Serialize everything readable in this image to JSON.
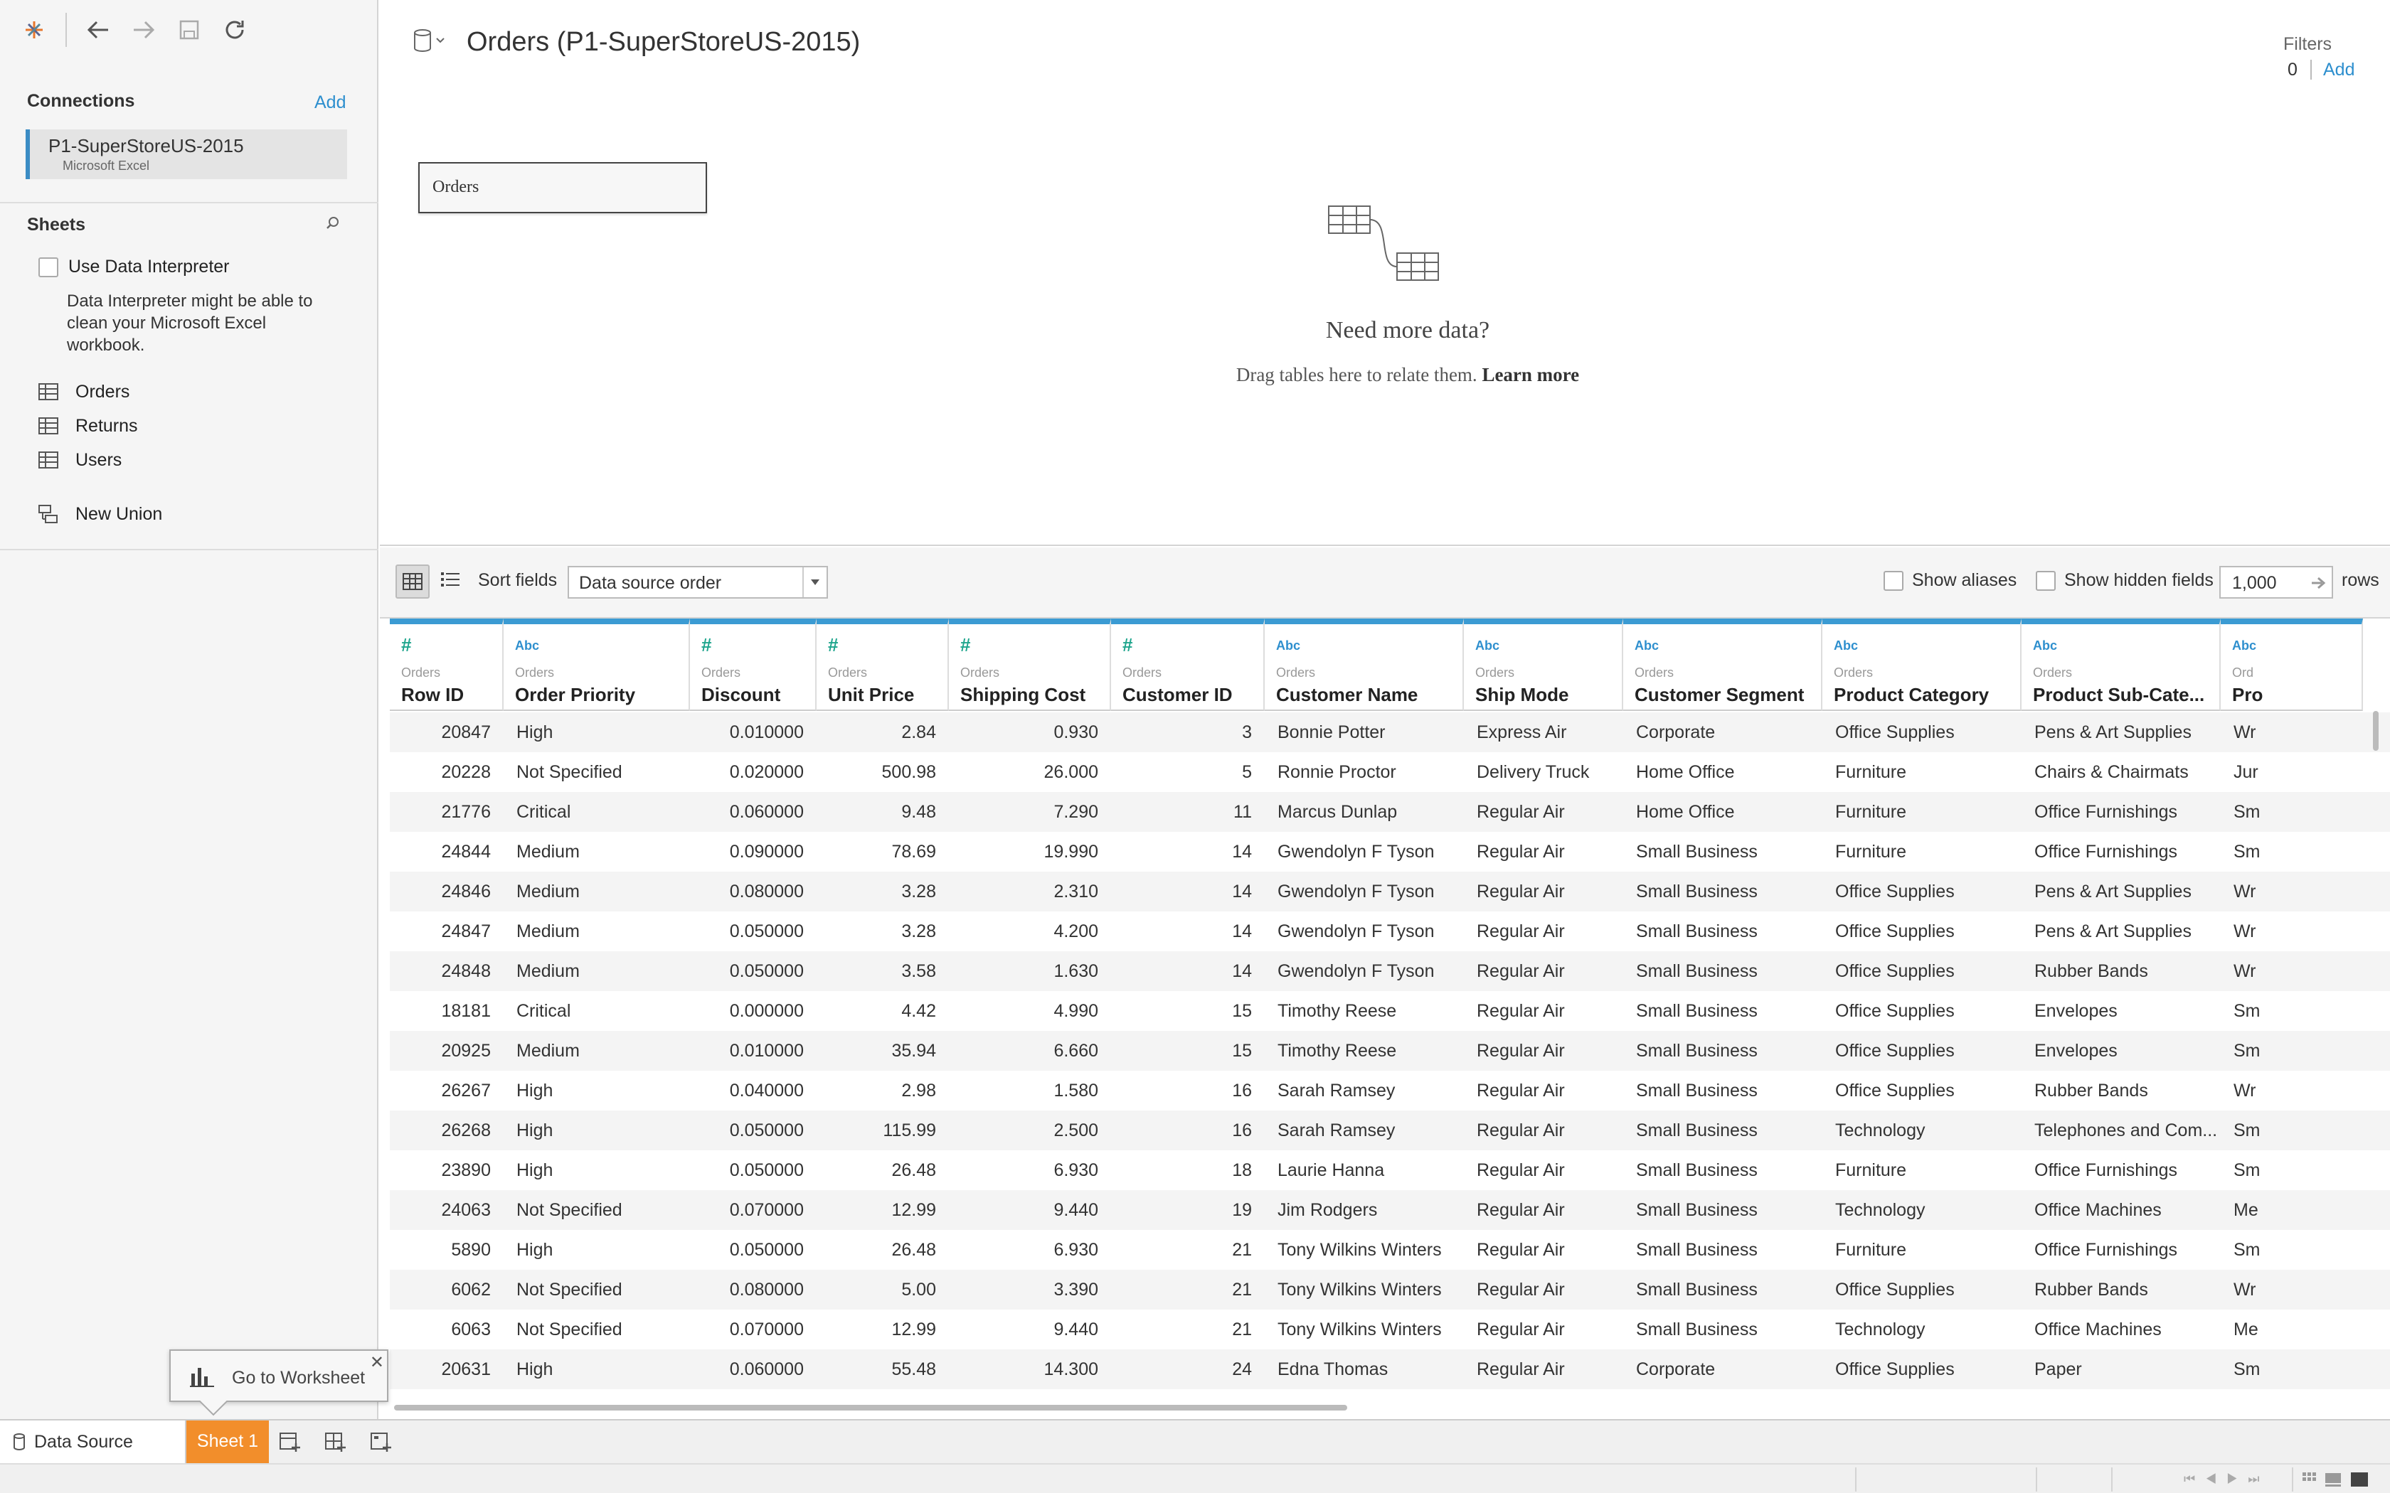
{
  "toolbar": {
    "icons": [
      "tableau-logo-icon",
      "back-icon",
      "forward-icon",
      "save-icon",
      "refresh-icon"
    ]
  },
  "connections": {
    "title": "Connections",
    "add_label": "Add",
    "items": [
      {
        "name": "P1-SuperStoreUS-2015",
        "type": "Microsoft Excel"
      }
    ]
  },
  "sheets": {
    "title": "Sheets",
    "interpreter_label": "Use Data Interpreter",
    "interpreter_note": "Data Interpreter might be able to clean your Microsoft Excel workbook.",
    "items": [
      "Orders",
      "Returns",
      "Users"
    ],
    "new_union": "New Union"
  },
  "datasource": {
    "title": "Orders (P1-SuperStoreUS-2015)"
  },
  "filters": {
    "label": "Filters",
    "count": "0",
    "add_label": "Add"
  },
  "canvas": {
    "table_box": "Orders",
    "need_more": "Need more data?",
    "drag_hint": "Drag tables here to relate them.",
    "learn_more": "Learn more"
  },
  "gridbar": {
    "sort_label": "Sort fields",
    "sort_value": "Data source order",
    "show_aliases": "Show aliases",
    "show_hidden": "Show hidden fields",
    "rows_value": "1,000",
    "rows_label": "rows"
  },
  "table": {
    "columns": [
      {
        "type": "#",
        "source": "Orders",
        "name": "Row ID"
      },
      {
        "type": "Abc",
        "source": "Orders",
        "name": "Order Priority"
      },
      {
        "type": "#",
        "source": "Orders",
        "name": "Discount"
      },
      {
        "type": "#",
        "source": "Orders",
        "name": "Unit Price"
      },
      {
        "type": "#",
        "source": "Orders",
        "name": "Shipping Cost"
      },
      {
        "type": "#",
        "source": "Orders",
        "name": "Customer ID"
      },
      {
        "type": "Abc",
        "source": "Orders",
        "name": "Customer Name"
      },
      {
        "type": "Abc",
        "source": "Orders",
        "name": "Ship Mode"
      },
      {
        "type": "Abc",
        "source": "Orders",
        "name": "Customer Segment"
      },
      {
        "type": "Abc",
        "source": "Orders",
        "name": "Product Category"
      },
      {
        "type": "Abc",
        "source": "Orders",
        "name": "Product Sub-Cate..."
      },
      {
        "type": "Abc",
        "source": "Ord",
        "name": "Pro"
      }
    ],
    "rows": [
      [
        "20847",
        "High",
        "0.010000",
        "2.84",
        "0.930",
        "3",
        "Bonnie Potter",
        "Express Air",
        "Corporate",
        "Office Supplies",
        "Pens & Art Supplies",
        "Wr"
      ],
      [
        "20228",
        "Not Specified",
        "0.020000",
        "500.98",
        "26.000",
        "5",
        "Ronnie Proctor",
        "Delivery Truck",
        "Home Office",
        "Furniture",
        "Chairs & Chairmats",
        "Jur"
      ],
      [
        "21776",
        "Critical",
        "0.060000",
        "9.48",
        "7.290",
        "11",
        "Marcus Dunlap",
        "Regular Air",
        "Home Office",
        "Furniture",
        "Office Furnishings",
        "Sm"
      ],
      [
        "24844",
        "Medium",
        "0.090000",
        "78.69",
        "19.990",
        "14",
        "Gwendolyn F Tyson",
        "Regular Air",
        "Small Business",
        "Furniture",
        "Office Furnishings",
        "Sm"
      ],
      [
        "24846",
        "Medium",
        "0.080000",
        "3.28",
        "2.310",
        "14",
        "Gwendolyn F Tyson",
        "Regular Air",
        "Small Business",
        "Office Supplies",
        "Pens & Art Supplies",
        "Wr"
      ],
      [
        "24847",
        "Medium",
        "0.050000",
        "3.28",
        "4.200",
        "14",
        "Gwendolyn F Tyson",
        "Regular Air",
        "Small Business",
        "Office Supplies",
        "Pens & Art Supplies",
        "Wr"
      ],
      [
        "24848",
        "Medium",
        "0.050000",
        "3.58",
        "1.630",
        "14",
        "Gwendolyn F Tyson",
        "Regular Air",
        "Small Business",
        "Office Supplies",
        "Rubber Bands",
        "Wr"
      ],
      [
        "18181",
        "Critical",
        "0.000000",
        "4.42",
        "4.990",
        "15",
        "Timothy Reese",
        "Regular Air",
        "Small Business",
        "Office Supplies",
        "Envelopes",
        "Sm"
      ],
      [
        "20925",
        "Medium",
        "0.010000",
        "35.94",
        "6.660",
        "15",
        "Timothy Reese",
        "Regular Air",
        "Small Business",
        "Office Supplies",
        "Envelopes",
        "Sm"
      ],
      [
        "26267",
        "High",
        "0.040000",
        "2.98",
        "1.580",
        "16",
        "Sarah Ramsey",
        "Regular Air",
        "Small Business",
        "Office Supplies",
        "Rubber Bands",
        "Wr"
      ],
      [
        "26268",
        "High",
        "0.050000",
        "115.99",
        "2.500",
        "16",
        "Sarah Ramsey",
        "Regular Air",
        "Small Business",
        "Technology",
        "Telephones and Com...",
        "Sm"
      ],
      [
        "23890",
        "High",
        "0.050000",
        "26.48",
        "6.930",
        "18",
        "Laurie Hanna",
        "Regular Air",
        "Small Business",
        "Furniture",
        "Office Furnishings",
        "Sm"
      ],
      [
        "24063",
        "Not Specified",
        "0.070000",
        "12.99",
        "9.440",
        "19",
        "Jim Rodgers",
        "Regular Air",
        "Small Business",
        "Technology",
        "Office Machines",
        "Me"
      ],
      [
        "5890",
        "High",
        "0.050000",
        "26.48",
        "6.930",
        "21",
        "Tony Wilkins Winters",
        "Regular Air",
        "Small Business",
        "Furniture",
        "Office Furnishings",
        "Sm"
      ],
      [
        "6062",
        "Not Specified",
        "0.080000",
        "5.00",
        "3.390",
        "21",
        "Tony Wilkins Winters",
        "Regular Air",
        "Small Business",
        "Office Supplies",
        "Rubber Bands",
        "Wr"
      ],
      [
        "6063",
        "Not Specified",
        "0.070000",
        "12.99",
        "9.440",
        "21",
        "Tony Wilkins Winters",
        "Regular Air",
        "Small Business",
        "Technology",
        "Office Machines",
        "Me"
      ],
      [
        "20631",
        "High",
        "0.060000",
        "55.48",
        "14.300",
        "24",
        "Edna Thomas",
        "Regular Air",
        "Corporate",
        "Office Supplies",
        "Paper",
        "Sm"
      ]
    ]
  },
  "tooltip": {
    "label": "Go to Worksheet"
  },
  "tabs": {
    "data_source": "Data Source",
    "sheet1": "Sheet 1"
  },
  "colors": {
    "accent": "#3b9bd3",
    "active_tab": "#f28e2b",
    "number_type": "#1fa58d",
    "string_type": "#2e8fce"
  }
}
